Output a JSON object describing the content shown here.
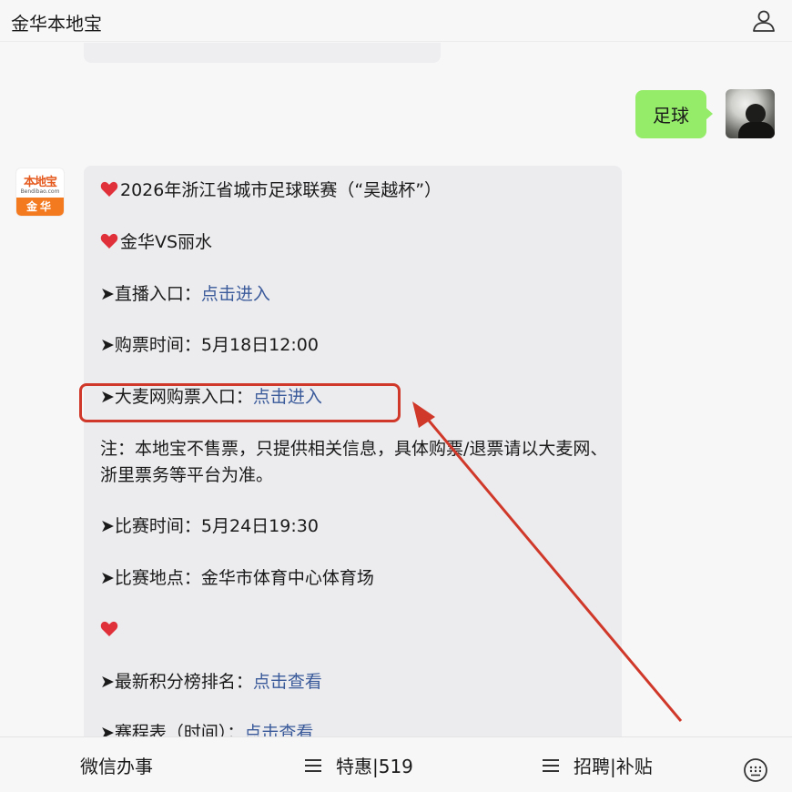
{
  "header": {
    "title": "金华本地宝",
    "user_icon": "user-icon"
  },
  "me_message": {
    "text": "足球",
    "bubble_color": "#95ec69"
  },
  "bot_avatar": {
    "logo_top": "本地宝",
    "logo_sub": "Bendibao.com",
    "logo_city": "金华"
  },
  "bot_message": {
    "line1": "2026年浙江省城市足球联赛（“吴越杯”）",
    "line2": "金华VS丽水",
    "live_label": "➤直播入口：",
    "live_link": "点击进入",
    "ticket_time": "➤购票时间：5月18日12:00",
    "damai_label": "➤大麦网购票入口：",
    "damai_link": "点击进入",
    "note": "注：本地宝不售票，只提供相关信息，具体购票/退票请以大麦网、浙里票务等平台为准。",
    "match_time": "➤比赛时间：5月24日19:30",
    "match_place": "➤比赛地点：金华市体育中心体育场",
    "ranking_label": "➤最新积分榜排名：",
    "ranking_link": "点击查看",
    "schedule_label": "➤赛程表（时间）：",
    "schedule_link": "点击查看",
    "link_color": "#3a5a9a"
  },
  "annotation": {
    "highlight_color": "#d0392a"
  },
  "bottom_menu": {
    "item1": "微信办事",
    "item2": "特惠|519",
    "item3": "招聘|补贴",
    "keyboard_icon": "keyboard-icon"
  }
}
